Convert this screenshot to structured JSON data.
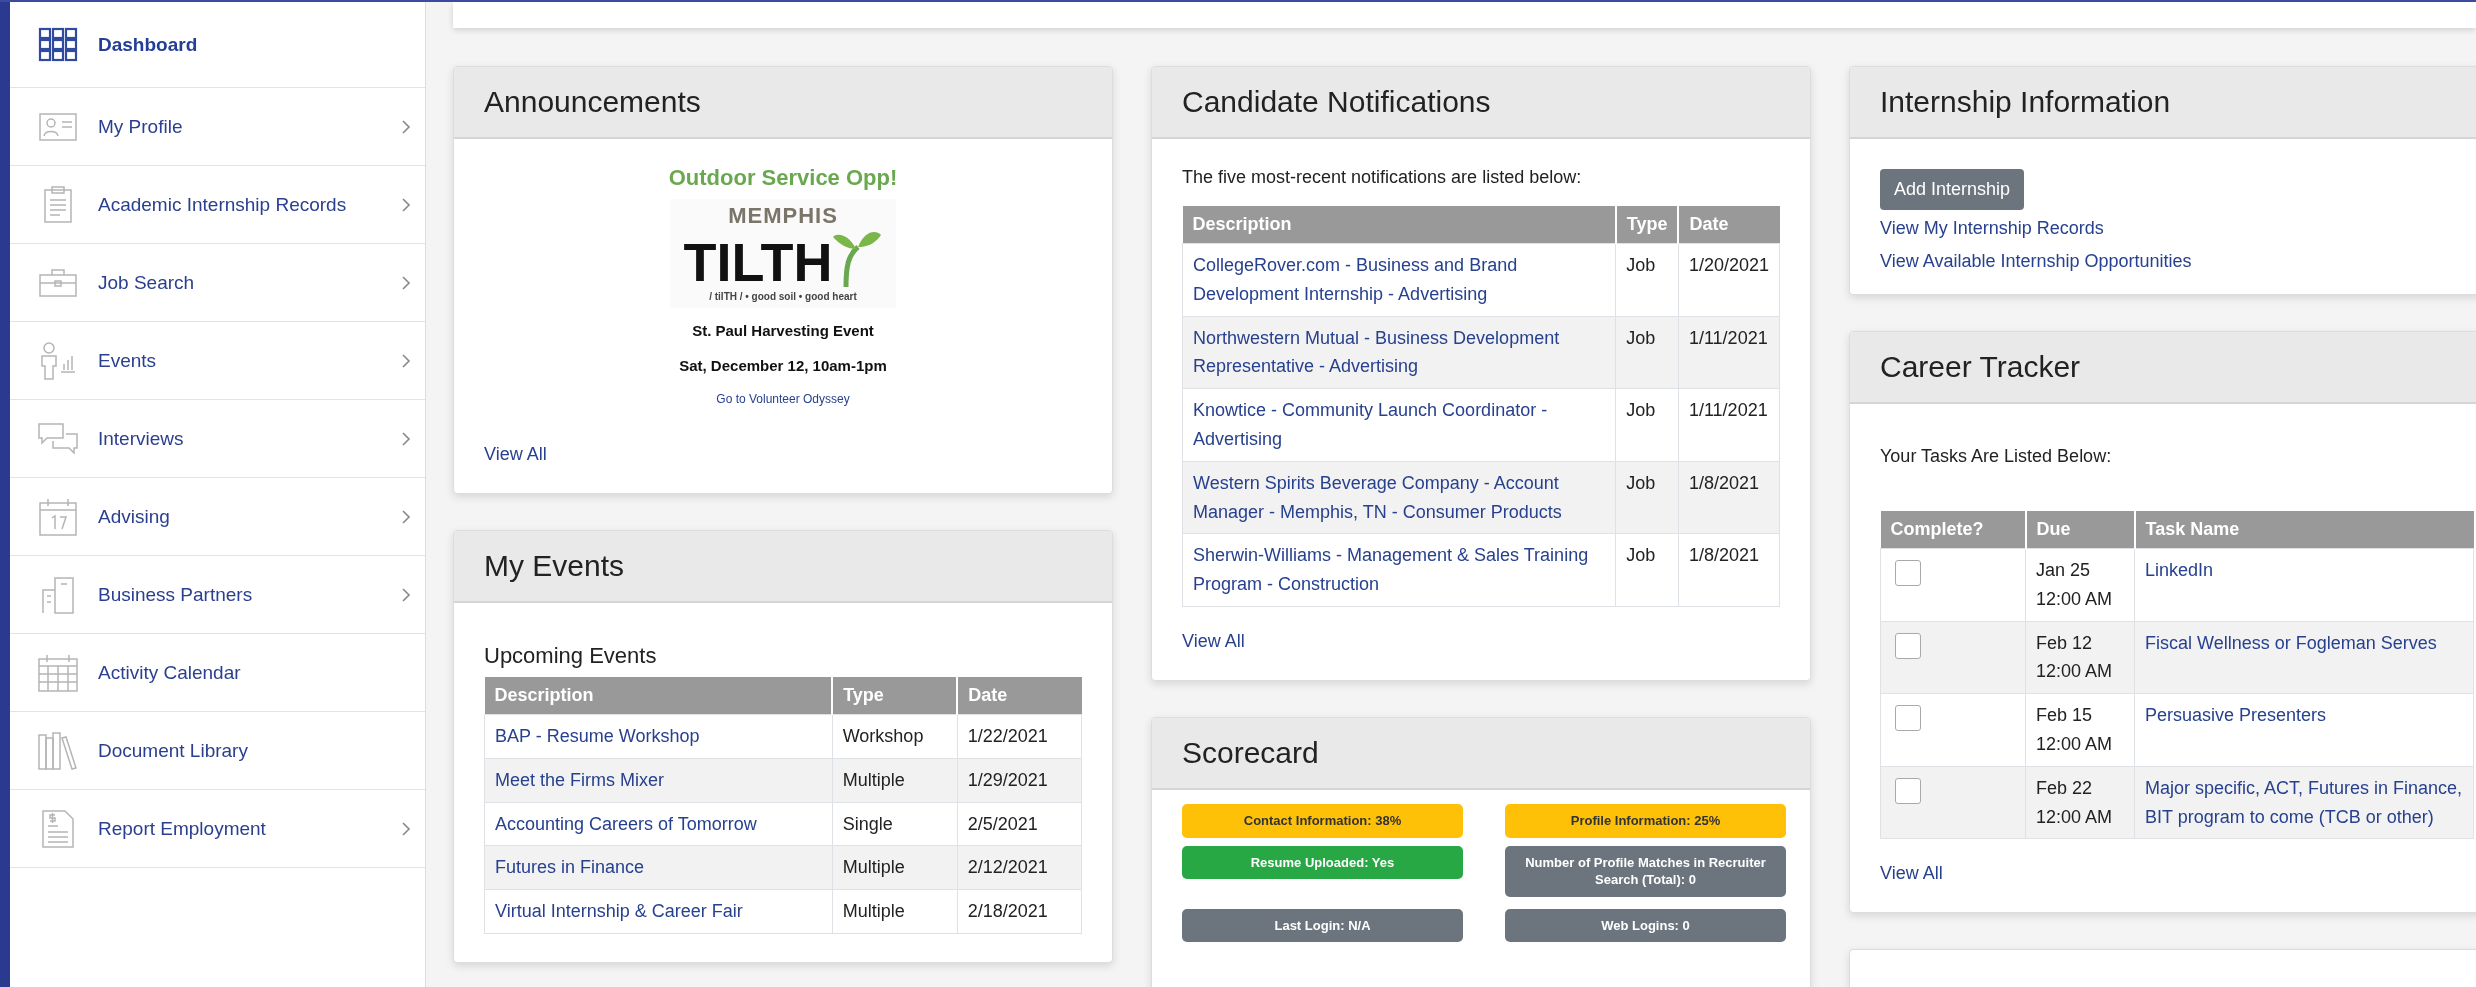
{
  "sidebar": {
    "items": [
      {
        "label": "Dashboard",
        "selected": true,
        "has_submenu": false
      },
      {
        "label": "My Profile",
        "selected": false,
        "has_submenu": true
      },
      {
        "label": "Academic Internship Records",
        "selected": false,
        "has_submenu": true
      },
      {
        "label": "Job Search",
        "selected": false,
        "has_submenu": true
      },
      {
        "label": "Events",
        "selected": false,
        "has_submenu": true
      },
      {
        "label": "Interviews",
        "selected": false,
        "has_submenu": true
      },
      {
        "label": "Advising",
        "selected": false,
        "has_submenu": true
      },
      {
        "label": "Business Partners",
        "selected": false,
        "has_submenu": true
      },
      {
        "label": "Activity Calendar",
        "selected": false,
        "has_submenu": false
      },
      {
        "label": "Document Library",
        "selected": false,
        "has_submenu": false
      },
      {
        "label": "Report Employment",
        "selected": false,
        "has_submenu": true
      }
    ]
  },
  "announcements": {
    "title": "Announcements",
    "headline": "Outdoor Service Opp!",
    "logo": {
      "line_1": "MEMPHIS",
      "line_2": "TILTH",
      "tagline": "/ tilTH / • good soil • good heart"
    },
    "event_name": "St. Paul Harvesting Event",
    "event_time": "Sat, December 12, 10am-1pm",
    "link": "Go to Volunteer Odyssey",
    "view_all": "View All"
  },
  "my_events": {
    "title": "My Events",
    "subtitle": "Upcoming Events",
    "columns": [
      "Description",
      "Type",
      "Date"
    ],
    "rows": [
      {
        "description": "BAP - Resume Workshop",
        "type": "Workshop",
        "date": "1/22/2021"
      },
      {
        "description": "Meet the Firms Mixer",
        "type": "Multiple",
        "date": "1/29/2021"
      },
      {
        "description": "Accounting Careers of Tomorrow",
        "type": "Single",
        "date": "2/5/2021"
      },
      {
        "description": "Futures in Finance",
        "type": "Multiple",
        "date": "2/12/2021"
      },
      {
        "description": "Virtual Internship & Career Fair",
        "type": "Multiple",
        "date": "2/18/2021"
      }
    ]
  },
  "candidate_notifications": {
    "title": "Candidate Notifications",
    "intro": "The five most-recent notifications are listed below:",
    "columns": [
      "Description",
      "Type",
      "Date"
    ],
    "rows": [
      {
        "description": "CollegeRover.com - Business and Brand Development Internship - Advertising",
        "type": "Job",
        "date": "1/20/2021"
      },
      {
        "description": "Northwestern Mutual - Business Development Representative - Advertising",
        "type": "Job",
        "date": "1/11/2021"
      },
      {
        "description": "Knowtice - Community Launch Coordinator - Advertising",
        "type": "Job",
        "date": "1/11/2021"
      },
      {
        "description": "Western Spirits Beverage Company - Account Manager - Memphis, TN - Consumer Products",
        "type": "Job",
        "date": "1/8/2021"
      },
      {
        "description": "Sherwin-Williams - Management & Sales Training Program - Construction",
        "type": "Job",
        "date": "1/8/2021"
      }
    ],
    "view_all": "View All"
  },
  "scorecard": {
    "title": "Scorecard",
    "items": [
      {
        "label": "Contact Information: 38%",
        "color": "#ffc107"
      },
      {
        "label": "Profile Information: 25%",
        "color": "#ffc107"
      },
      {
        "label": "Resume Uploaded: Yes",
        "color": "#28a745"
      },
      {
        "label": "Number of Profile Matches in Recruiter Search (Total): 0",
        "color": "#6c757d"
      },
      {
        "label": "Last Login: N/A",
        "color": "#6c757d"
      },
      {
        "label": "Web Logins: 0",
        "color": "#6c757d"
      }
    ]
  },
  "internship_information": {
    "title": "Internship Information",
    "button": "Add Internship",
    "links": [
      "View My Internship Records",
      "View Available Internship Opportunities"
    ]
  },
  "career_tracker": {
    "title": "Career Tracker",
    "intro": "Your Tasks Are Listed Below:",
    "columns": [
      "Complete?",
      "Due",
      "Task Name"
    ],
    "tasks": [
      {
        "checked": false,
        "due": "Jan 25 12:00 AM",
        "name": "LinkedIn"
      },
      {
        "checked": false,
        "due": "Feb 12 12:00 AM",
        "name": "Fiscal Wellness or Fogleman Serves"
      },
      {
        "checked": false,
        "due": "Feb 15 12:00 AM",
        "name": "Persuasive Presenters"
      },
      {
        "checked": false,
        "due": "Feb 22 12:00 AM",
        "name": "Major specific, ACT, Futures in Finance, BIT program to come (TCB or other)"
      }
    ],
    "view_all": "View All"
  }
}
